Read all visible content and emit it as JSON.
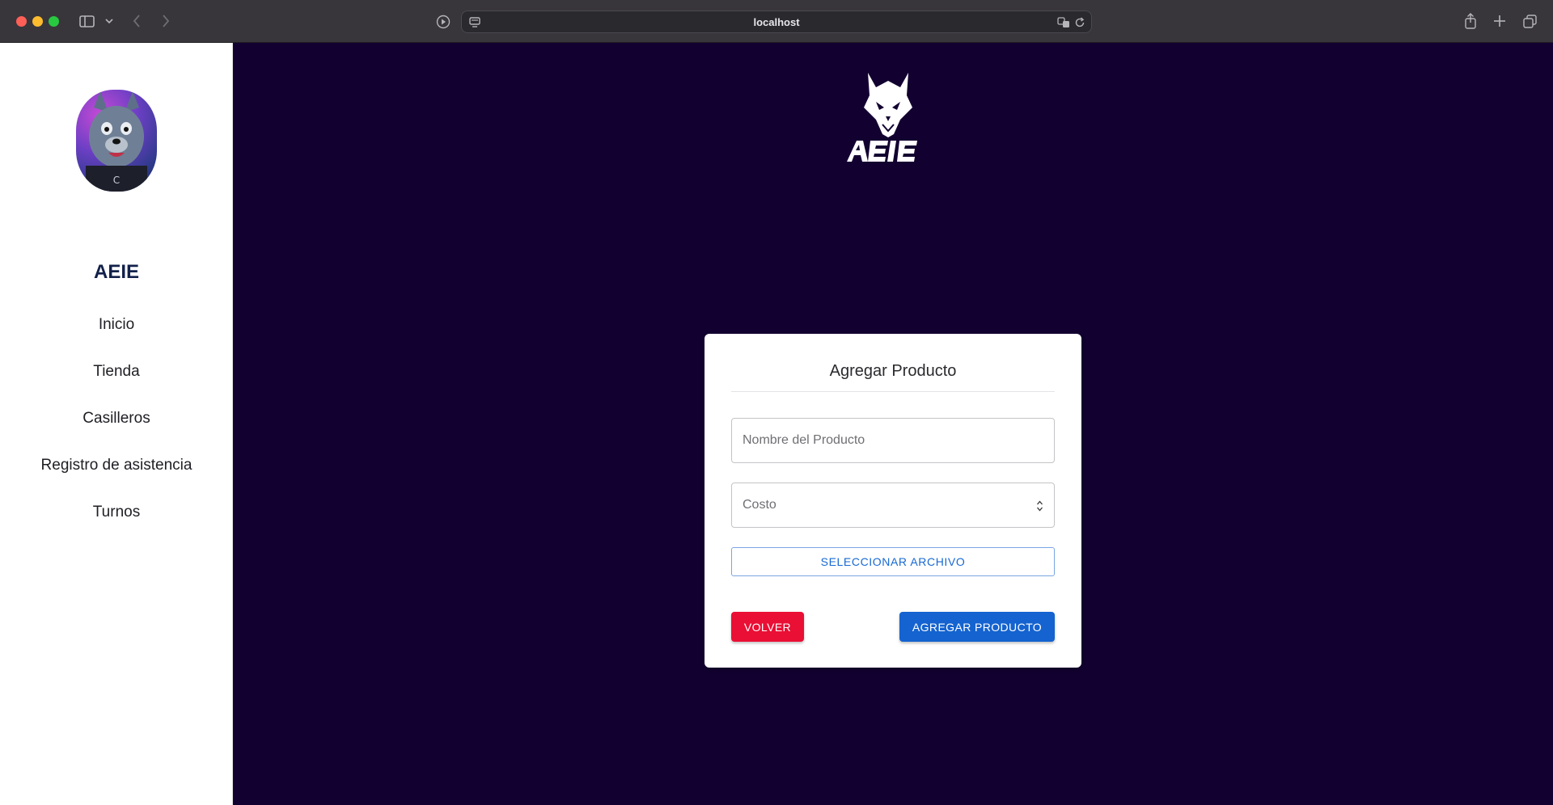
{
  "browser": {
    "url": "localhost",
    "traffic_light_colors": {
      "close": "#fe5f57",
      "minimize": "#febc2e",
      "maximize": "#28c840"
    },
    "icons": {
      "sidebar": "sidebar-toggle-icon",
      "chevron": "chevron-down-icon",
      "back": "back-arrow-icon",
      "forward": "forward-arrow-icon",
      "media": "play-icon",
      "page": "page-menu-icon",
      "translate": "translate-icon",
      "reload": "reload-icon",
      "share": "share-icon",
      "new_tab": "plus-icon",
      "tabs": "tab-overview-icon"
    }
  },
  "sidebar": {
    "brand": "AEIE",
    "items": [
      {
        "label": "Inicio"
      },
      {
        "label": "Tienda"
      },
      {
        "label": "Casilleros"
      },
      {
        "label": "Registro de asistencia"
      },
      {
        "label": "Turnos"
      }
    ]
  },
  "main": {
    "background": "#120130",
    "logo_text": "AEIE"
  },
  "form": {
    "title": "Agregar Producto",
    "name_placeholder": "Nombre del Producto",
    "cost_placeholder": "Costo",
    "file_button": "SELECCIONAR ARCHIVO",
    "back_button": "VOLVER",
    "submit_button": "AGREGAR PRODUCTO",
    "colors": {
      "back": "#ea0f34",
      "submit": "#1463d0",
      "file_text": "#1768d2"
    }
  }
}
